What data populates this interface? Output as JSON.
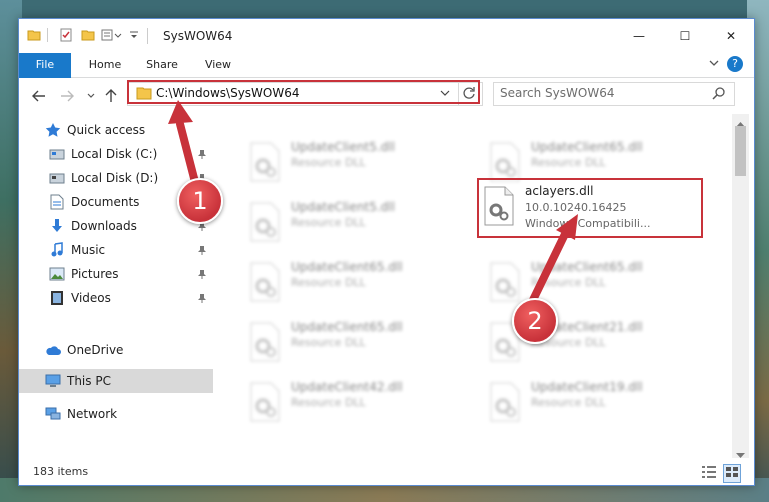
{
  "window": {
    "title": "SysWOW64"
  },
  "window_controls": {
    "minimize": "—",
    "maximize": "☐",
    "close": "✕",
    "help": "?"
  },
  "ribbon": {
    "tabs": [
      "File",
      "Home",
      "Share",
      "View"
    ]
  },
  "address": {
    "path": "C:\\Windows\\SysWOW64"
  },
  "search": {
    "placeholder": "Search SysWOW64"
  },
  "sidebar": {
    "items": [
      {
        "label": "Quick access",
        "icon": "star-icon"
      },
      {
        "label": "Local Disk (C:)",
        "icon": "drive-icon"
      },
      {
        "label": "Local Disk (D:)",
        "icon": "drive-icon"
      },
      {
        "label": "Documents",
        "icon": "documents-icon"
      },
      {
        "label": "Downloads",
        "icon": "download-arrow-icon"
      },
      {
        "label": "Music",
        "icon": "music-icon"
      },
      {
        "label": "Pictures",
        "icon": "pictures-icon"
      },
      {
        "label": "Videos",
        "icon": "videos-icon"
      },
      {
        "label": "OneDrive",
        "icon": "cloud-icon"
      },
      {
        "label": "This PC",
        "icon": "computer-icon"
      },
      {
        "label": "Network",
        "icon": "network-icon"
      }
    ]
  },
  "files": {
    "left": [
      {
        "name": "UpdateClient5.dll",
        "type": "Resource DLL"
      },
      {
        "name": "UpdateClient5.dll",
        "type": "Resource DLL"
      },
      {
        "name": "UpdateClient65.dll",
        "type": "Resource DLL"
      },
      {
        "name": "UpdateClient65.dll",
        "type": "Resource DLL"
      },
      {
        "name": "UpdateClient42.dll",
        "type": "Resource DLL"
      }
    ],
    "right": [
      {
        "name": "UpdateClient65.dll",
        "type": "Resource DLL"
      },
      {
        "name": "UpdateClient65.dll",
        "type": "Resource DLL"
      },
      {
        "name": "UpdateClient21.dll",
        "type": "Resource DLL"
      },
      {
        "name": "UpdateClient19.dll",
        "type": "Resource DLL"
      }
    ],
    "selected": {
      "name": "aclayers.dll",
      "version": "10.0.10240.16425",
      "description": "Windows Compatibili..."
    }
  },
  "status": {
    "items_count": "183 items"
  },
  "callouts": [
    "1",
    "2"
  ],
  "colors": {
    "accent": "#1979ca",
    "highlight": "#c8323a"
  }
}
